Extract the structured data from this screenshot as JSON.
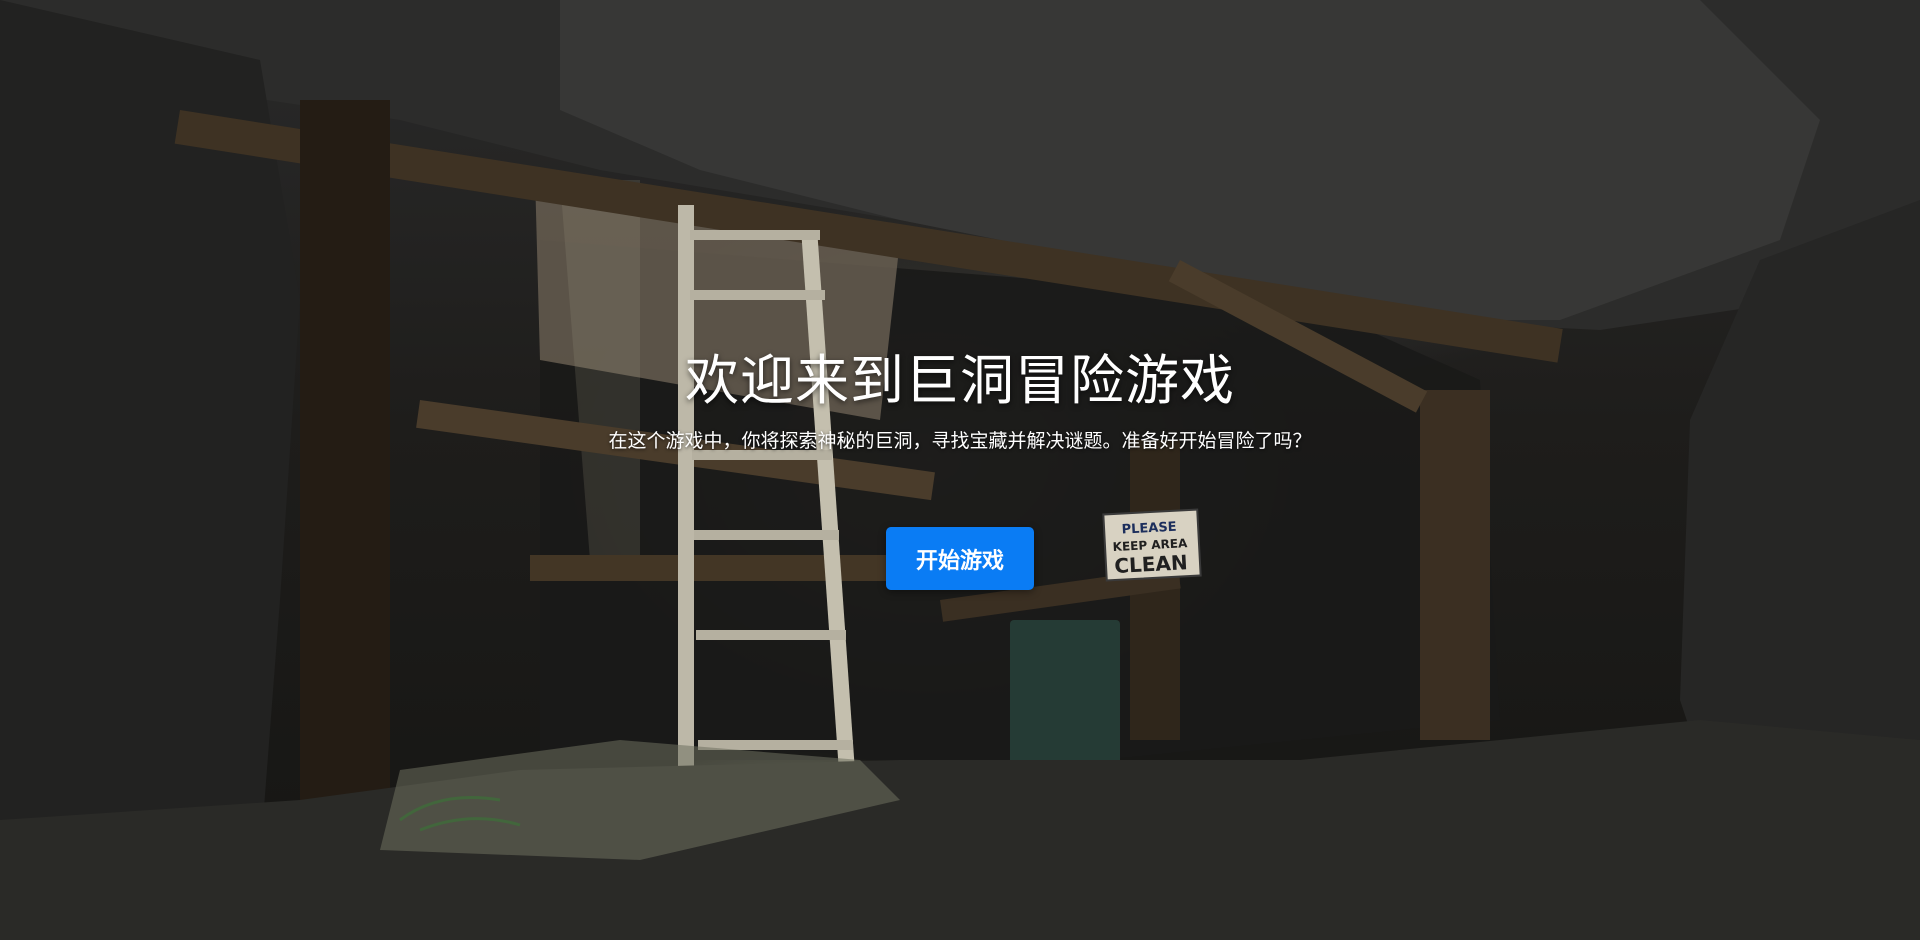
{
  "hero": {
    "title": "欢迎来到巨洞冒险游戏",
    "subtitle": "在这个游戏中，你将探索神秘的巨洞，寻找宝藏并解决谜题。准备好开始冒险了吗？",
    "start_button_label": "开始游戏"
  },
  "background": {
    "description_icon": "cave-mine-scene",
    "sign": {
      "line1": "PLEASE",
      "line2": "KEEP AREA",
      "line3": "CLEAN"
    }
  },
  "colors": {
    "accent": "#0a7cf4",
    "text": "#ffffff",
    "cave_dark": "#141414"
  }
}
